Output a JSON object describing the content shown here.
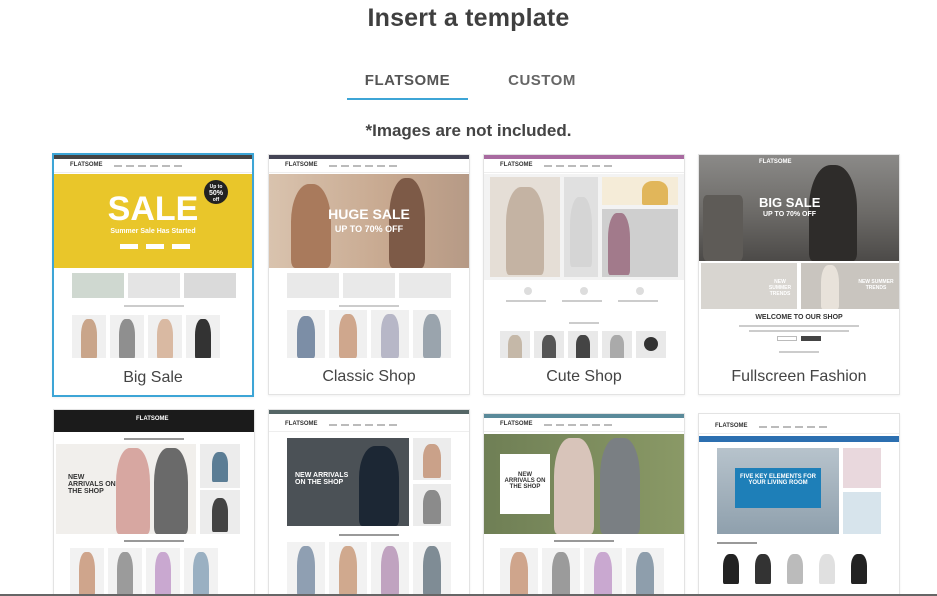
{
  "dialog": {
    "title": "Insert a template"
  },
  "tabs": [
    {
      "label": "FLATSOME",
      "active": true
    },
    {
      "label": "CUSTOM",
      "active": false
    }
  ],
  "note": "*Images are not included.",
  "templates": [
    {
      "label": "Big Sale",
      "selected": true
    },
    {
      "label": "Classic Shop",
      "selected": false
    },
    {
      "label": "Cute Shop",
      "selected": false
    },
    {
      "label": "Fullscreen Fashion",
      "selected": false
    },
    {
      "label": "",
      "selected": false
    },
    {
      "label": "",
      "selected": false
    },
    {
      "label": "",
      "selected": false
    },
    {
      "label": "",
      "selected": false
    }
  ],
  "previews": {
    "brand": "FLATSOME",
    "big_sale": {
      "hero": "SALE",
      "sub": "Summer Sale Has Started",
      "badge_top": "Up to",
      "badge_pct": "50%",
      "badge_off": "off"
    },
    "classic": {
      "hero": "HUGE SALE",
      "sub": "UP TO 70% OFF"
    },
    "fullscreen": {
      "hero": "BIG SALE",
      "sub": "UP TO 70% OFF",
      "welcome": "WELCOME TO OUR SHOP",
      "promo": "NEW SUMMER TRENDS"
    },
    "r2c1": {
      "hero": "NEW ARRIVALS ON THE SHOP"
    },
    "r2c2": {
      "hero": "NEW ARRIVALS ON THE SHOP"
    },
    "r2c3": {
      "hero": "NEW ARRIVALS ON THE SHOP"
    },
    "r2c4": {
      "hero": "FIVE KEY ELEMENTS FOR YOUR LIVING ROOM"
    }
  },
  "colors": {
    "accent": "#3da5d6",
    "sale_yellow": "#e9c62a",
    "dark_nav": "#1b1b1b"
  }
}
